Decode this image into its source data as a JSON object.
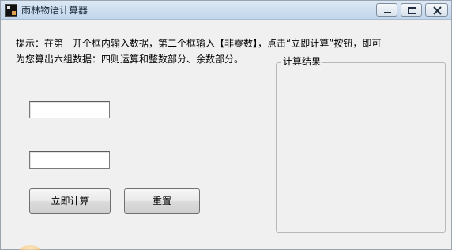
{
  "window": {
    "title": "雨林物语计算器",
    "icon": "app-icon"
  },
  "titlebar_buttons": {
    "minimize_icon": "minimize-icon",
    "maximize_icon": "maximize-icon",
    "close_icon": "close-icon"
  },
  "hint": {
    "line1": "提示：在第一开个框内输入数据，第二个框输入【非零数】，点击“立即计算”按钮，即可",
    "line2": "为您算出六组数据：四则运算和整数部分、余数部分。"
  },
  "inputs": {
    "first_value": "",
    "second_value": ""
  },
  "buttons": {
    "calculate_label": "立即计算",
    "reset_label": "重置"
  },
  "result_group": {
    "legend": "计算结果"
  },
  "colors": {
    "titlebar": "#cfdff0",
    "window_bg": "#f0f0f0"
  }
}
